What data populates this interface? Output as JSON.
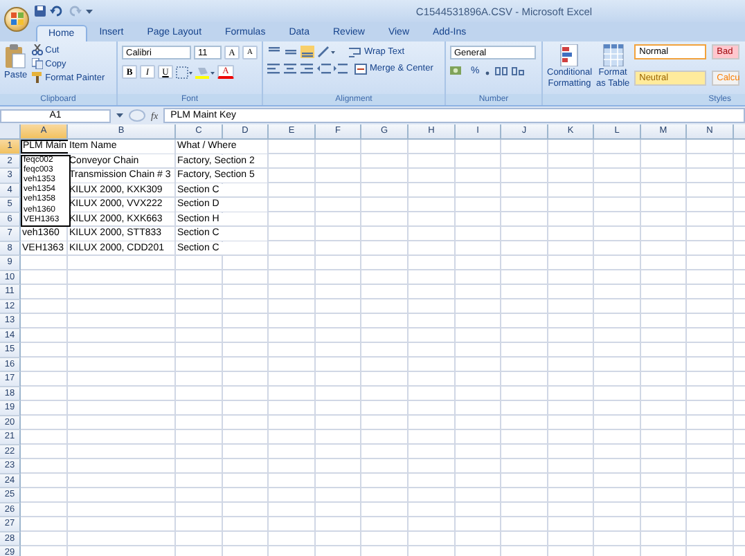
{
  "window": {
    "title": "C1544531896A.CSV - Microsoft Excel"
  },
  "tabs": [
    {
      "label": "Home",
      "selected": true
    },
    {
      "label": "Insert",
      "selected": false
    },
    {
      "label": "Page Layout",
      "selected": false
    },
    {
      "label": "Formulas",
      "selected": false
    },
    {
      "label": "Data",
      "selected": false
    },
    {
      "label": "Review",
      "selected": false
    },
    {
      "label": "View",
      "selected": false
    },
    {
      "label": "Add-Ins",
      "selected": false
    }
  ],
  "clipboard": {
    "label": "Clipboard",
    "paste": "Paste",
    "items": [
      "Cut",
      "Copy",
      "Format Painter"
    ]
  },
  "font": {
    "label": "Font",
    "name": "Calibri",
    "size": "11",
    "grow": "A",
    "shrink": "A",
    "styles": [
      "B",
      "I",
      "U"
    ],
    "color_letter": "A"
  },
  "alignment": {
    "label": "Alignment",
    "wrap": "Wrap Text",
    "merge": "Merge & Center"
  },
  "number": {
    "label": "Number",
    "format": "General",
    "percent": "%"
  },
  "styles": {
    "label": "Styles",
    "conditional": [
      "Conditional",
      "Formatting"
    ],
    "table": [
      "Format",
      "as Table"
    ],
    "cells": [
      {
        "label": "Normal",
        "kind": "normal",
        "selected": true
      },
      {
        "label": "Bad",
        "kind": "bad",
        "selected": false
      },
      {
        "label": "Neutral",
        "kind": "neutral",
        "selected": false
      },
      {
        "label": "Calcu",
        "kind": "calculation",
        "selected": false
      }
    ]
  },
  "formula_bar": {
    "name_box": "A1",
    "function_label": "fx",
    "value": "PLM Maint Key"
  },
  "sheet": {
    "columns": [
      {
        "label": "A",
        "selected": true
      },
      {
        "label": "B",
        "selected": false
      },
      {
        "label": "C",
        "selected": false
      },
      {
        "label": "D",
        "selected": false
      },
      {
        "label": "E",
        "selected": false
      },
      {
        "label": "F",
        "selected": false
      },
      {
        "label": "G",
        "selected": false
      },
      {
        "label": "H",
        "selected": false
      },
      {
        "label": "I",
        "selected": false
      },
      {
        "label": "J",
        "selected": false
      },
      {
        "label": "K",
        "selected": false
      },
      {
        "label": "L",
        "selected": false
      },
      {
        "label": "M",
        "selected": false
      },
      {
        "label": "N",
        "selected": false
      }
    ],
    "rows": [
      {
        "number": "1",
        "selected": true,
        "a": "PLM Main",
        "b": "Item Name",
        "c": "What / Where"
      },
      {
        "number": "2",
        "selected": false,
        "b": "Conveyor Chain",
        "c": "Factory, Section 2"
      },
      {
        "number": "3",
        "selected": false,
        "b": "Transmission Chain # 3",
        "c": "Factory, Section 5"
      },
      {
        "number": "4",
        "selected": false,
        "b": "KILUX 2000, KXK309",
        "c": "Section C"
      },
      {
        "number": "5",
        "selected": false,
        "b": "KILUX 2000, VVX222",
        "c": "Section D"
      },
      {
        "number": "6",
        "selected": false,
        "b": "KILUX 2000, KXK663",
        "c": "Section H"
      },
      {
        "number": "7",
        "selected": false,
        "a": "veh1360",
        "b": "KILUX 2000, STT833",
        "c": "Section C"
      },
      {
        "number": "8",
        "selected": false,
        "a": "VEH1363",
        "b": "KILUX 2000, CDD201",
        "c": "Section C"
      },
      {
        "number": "9",
        "selected": false
      },
      {
        "number": "10",
        "selected": false
      },
      {
        "number": "11",
        "selected": false
      },
      {
        "number": "12",
        "selected": false
      },
      {
        "number": "13",
        "selected": false
      },
      {
        "number": "14",
        "selected": false
      },
      {
        "number": "15",
        "selected": false
      },
      {
        "number": "16",
        "selected": false
      },
      {
        "number": "17",
        "selected": false
      },
      {
        "number": "18",
        "selected": false
      },
      {
        "number": "19",
        "selected": false
      },
      {
        "number": "20",
        "selected": false
      },
      {
        "number": "21",
        "selected": false
      },
      {
        "number": "22",
        "selected": false
      },
      {
        "number": "23",
        "selected": false
      },
      {
        "number": "24",
        "selected": false
      },
      {
        "number": "25",
        "selected": false
      },
      {
        "number": "26",
        "selected": false
      },
      {
        "number": "27",
        "selected": false
      },
      {
        "number": "28",
        "selected": false
      },
      {
        "number": "29",
        "selected": false
      }
    ]
  },
  "autocomplete": {
    "items": [
      "feqc002",
      "feqc003",
      "veh1353",
      "veh1354",
      "veh1358",
      "veh1360",
      "VEH1363"
    ]
  }
}
